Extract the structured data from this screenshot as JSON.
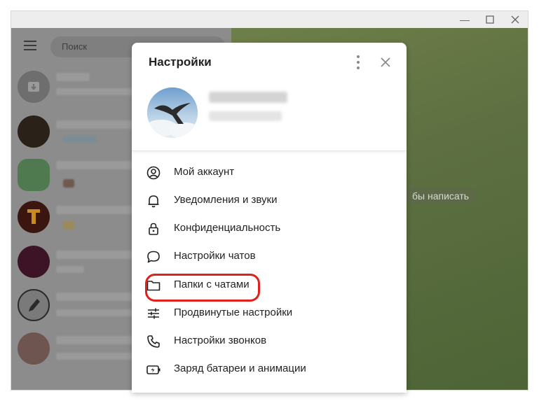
{
  "search": {
    "placeholder": "Поиск"
  },
  "chat_pane": {
    "hint": "бы написать"
  },
  "settings": {
    "title": "Настройки",
    "menu": [
      {
        "label": "Мой аккаунт",
        "icon": "account-circle-icon"
      },
      {
        "label": "Уведомления и звуки",
        "icon": "bell-icon"
      },
      {
        "label": "Конфиденциальность",
        "icon": "lock-icon"
      },
      {
        "label": "Настройки чатов",
        "icon": "chat-bubble-icon"
      },
      {
        "label": "Папки с чатами",
        "icon": "folder-icon"
      },
      {
        "label": "Продвинутые настройки",
        "icon": "sliders-icon"
      },
      {
        "label": "Настройки звонков",
        "icon": "phone-icon"
      },
      {
        "label": "Заряд батареи и анимации",
        "icon": "battery-icon"
      }
    ]
  },
  "colors": {
    "highlight": "#e0201c",
    "chat_background": "#5e7041",
    "dim_overlay": "#8c8c8c"
  }
}
